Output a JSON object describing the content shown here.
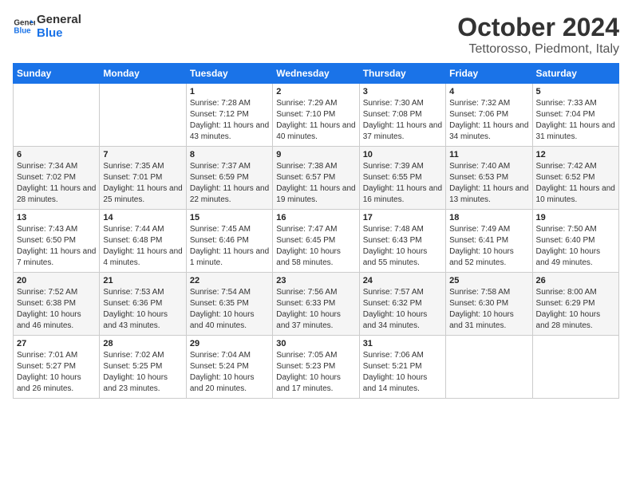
{
  "logo": {
    "line1": "General",
    "line2": "Blue"
  },
  "title": "October 2024",
  "subtitle": "Tettorosso, Piedmont, Italy",
  "headers": [
    "Sunday",
    "Monday",
    "Tuesday",
    "Wednesday",
    "Thursday",
    "Friday",
    "Saturday"
  ],
  "weeks": [
    [
      {
        "day": "",
        "info": ""
      },
      {
        "day": "",
        "info": ""
      },
      {
        "day": "1",
        "info": "Sunrise: 7:28 AM\nSunset: 7:12 PM\nDaylight: 11 hours and 43 minutes."
      },
      {
        "day": "2",
        "info": "Sunrise: 7:29 AM\nSunset: 7:10 PM\nDaylight: 11 hours and 40 minutes."
      },
      {
        "day": "3",
        "info": "Sunrise: 7:30 AM\nSunset: 7:08 PM\nDaylight: 11 hours and 37 minutes."
      },
      {
        "day": "4",
        "info": "Sunrise: 7:32 AM\nSunset: 7:06 PM\nDaylight: 11 hours and 34 minutes."
      },
      {
        "day": "5",
        "info": "Sunrise: 7:33 AM\nSunset: 7:04 PM\nDaylight: 11 hours and 31 minutes."
      }
    ],
    [
      {
        "day": "6",
        "info": "Sunrise: 7:34 AM\nSunset: 7:02 PM\nDaylight: 11 hours and 28 minutes."
      },
      {
        "day": "7",
        "info": "Sunrise: 7:35 AM\nSunset: 7:01 PM\nDaylight: 11 hours and 25 minutes."
      },
      {
        "day": "8",
        "info": "Sunrise: 7:37 AM\nSunset: 6:59 PM\nDaylight: 11 hours and 22 minutes."
      },
      {
        "day": "9",
        "info": "Sunrise: 7:38 AM\nSunset: 6:57 PM\nDaylight: 11 hours and 19 minutes."
      },
      {
        "day": "10",
        "info": "Sunrise: 7:39 AM\nSunset: 6:55 PM\nDaylight: 11 hours and 16 minutes."
      },
      {
        "day": "11",
        "info": "Sunrise: 7:40 AM\nSunset: 6:53 PM\nDaylight: 11 hours and 13 minutes."
      },
      {
        "day": "12",
        "info": "Sunrise: 7:42 AM\nSunset: 6:52 PM\nDaylight: 11 hours and 10 minutes."
      }
    ],
    [
      {
        "day": "13",
        "info": "Sunrise: 7:43 AM\nSunset: 6:50 PM\nDaylight: 11 hours and 7 minutes."
      },
      {
        "day": "14",
        "info": "Sunrise: 7:44 AM\nSunset: 6:48 PM\nDaylight: 11 hours and 4 minutes."
      },
      {
        "day": "15",
        "info": "Sunrise: 7:45 AM\nSunset: 6:46 PM\nDaylight: 11 hours and 1 minute."
      },
      {
        "day": "16",
        "info": "Sunrise: 7:47 AM\nSunset: 6:45 PM\nDaylight: 10 hours and 58 minutes."
      },
      {
        "day": "17",
        "info": "Sunrise: 7:48 AM\nSunset: 6:43 PM\nDaylight: 10 hours and 55 minutes."
      },
      {
        "day": "18",
        "info": "Sunrise: 7:49 AM\nSunset: 6:41 PM\nDaylight: 10 hours and 52 minutes."
      },
      {
        "day": "19",
        "info": "Sunrise: 7:50 AM\nSunset: 6:40 PM\nDaylight: 10 hours and 49 minutes."
      }
    ],
    [
      {
        "day": "20",
        "info": "Sunrise: 7:52 AM\nSunset: 6:38 PM\nDaylight: 10 hours and 46 minutes."
      },
      {
        "day": "21",
        "info": "Sunrise: 7:53 AM\nSunset: 6:36 PM\nDaylight: 10 hours and 43 minutes."
      },
      {
        "day": "22",
        "info": "Sunrise: 7:54 AM\nSunset: 6:35 PM\nDaylight: 10 hours and 40 minutes."
      },
      {
        "day": "23",
        "info": "Sunrise: 7:56 AM\nSunset: 6:33 PM\nDaylight: 10 hours and 37 minutes."
      },
      {
        "day": "24",
        "info": "Sunrise: 7:57 AM\nSunset: 6:32 PM\nDaylight: 10 hours and 34 minutes."
      },
      {
        "day": "25",
        "info": "Sunrise: 7:58 AM\nSunset: 6:30 PM\nDaylight: 10 hours and 31 minutes."
      },
      {
        "day": "26",
        "info": "Sunrise: 8:00 AM\nSunset: 6:29 PM\nDaylight: 10 hours and 28 minutes."
      }
    ],
    [
      {
        "day": "27",
        "info": "Sunrise: 7:01 AM\nSunset: 5:27 PM\nDaylight: 10 hours and 26 minutes."
      },
      {
        "day": "28",
        "info": "Sunrise: 7:02 AM\nSunset: 5:25 PM\nDaylight: 10 hours and 23 minutes."
      },
      {
        "day": "29",
        "info": "Sunrise: 7:04 AM\nSunset: 5:24 PM\nDaylight: 10 hours and 20 minutes."
      },
      {
        "day": "30",
        "info": "Sunrise: 7:05 AM\nSunset: 5:23 PM\nDaylight: 10 hours and 17 minutes."
      },
      {
        "day": "31",
        "info": "Sunrise: 7:06 AM\nSunset: 5:21 PM\nDaylight: 10 hours and 14 minutes."
      },
      {
        "day": "",
        "info": ""
      },
      {
        "day": "",
        "info": ""
      }
    ]
  ]
}
